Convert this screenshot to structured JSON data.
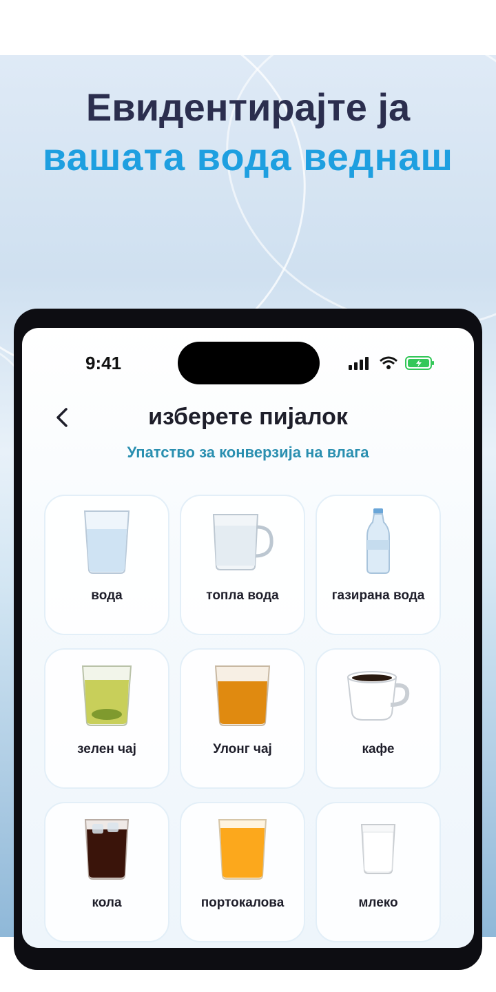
{
  "headline": {
    "line1": "Евидентирајте ја",
    "line2": "вашата вода веднаш"
  },
  "status": {
    "time": "9:41"
  },
  "header": {
    "title": "изберете пијалок",
    "subtitle": "Упатство за конверзија на влага"
  },
  "drinks": [
    {
      "label": "вода",
      "icon": "water-glass-icon"
    },
    {
      "label": "топла вода",
      "icon": "glass-mug-icon"
    },
    {
      "label": "газирана вода",
      "icon": "water-bottle-icon"
    },
    {
      "label": "зелен чај",
      "icon": "green-tea-glass-icon"
    },
    {
      "label": "Улонг чај",
      "icon": "oolong-tea-glass-icon"
    },
    {
      "label": "кафе",
      "icon": "coffee-cup-icon"
    },
    {
      "label": "кола",
      "icon": "cola-glass-icon"
    },
    {
      "label": "портокалова",
      "icon": "orange-juice-glass-icon"
    },
    {
      "label": "млеко",
      "icon": "milk-glass-icon"
    }
  ],
  "colors": {
    "headline_dark": "#2b2e4e",
    "headline_accent": "#1e9fe0",
    "subtitle": "#2a8fb0",
    "battery": "#34c759"
  }
}
